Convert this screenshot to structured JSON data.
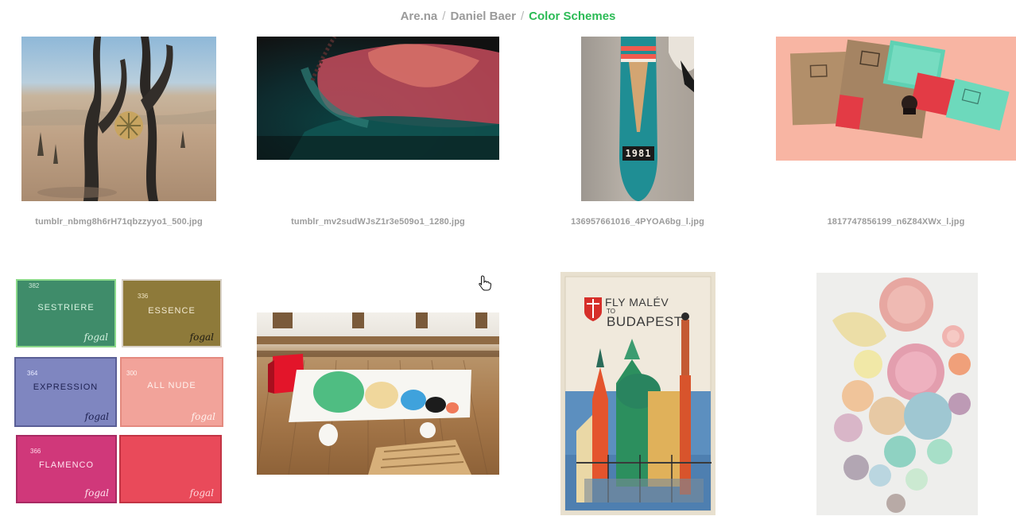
{
  "breadcrumb": {
    "items": [
      "Are.na",
      "Daniel Baer"
    ],
    "separator": "/",
    "current": "Color Schemes"
  },
  "blocks": [
    {
      "caption": "tumblr_nbmg8h6rH71qbzzyyo1_500.jpg"
    },
    {
      "caption": "tumblr_mv2sudWJsZ1r3e509o1_1280.jpg"
    },
    {
      "caption": "136957661016_4PYOA6bg_l.jpg"
    },
    {
      "caption": "1817747856199_n6Z84XWx_l.jpg"
    }
  ],
  "fogal_boxes": [
    {
      "number": "382",
      "name": "SESTRIERE",
      "color": "#3f8c6a"
    },
    {
      "number": "336",
      "name": "ESSENCE",
      "color": "#8e7a3a"
    },
    {
      "number": "364",
      "name": "EXPRESSION",
      "color": "#7f86c0"
    },
    {
      "number": "300",
      "name": "ALL NUDE",
      "color": "#f2a39a"
    },
    {
      "number": "366",
      "name": "FLAMENCO",
      "color": "#d0387a"
    },
    {
      "number": "",
      "name": "",
      "color": "#e94a5a"
    }
  ],
  "fogal_brand": "fogal",
  "skateboard_year": "1981",
  "poster": {
    "line1": "FLY MALÉV",
    "line2": "TO",
    "line3": "BUDAPEST"
  },
  "colors": {
    "accent": "#2bbb55",
    "crumb": "#9a9a9a",
    "caption": "#9c9c9c"
  }
}
